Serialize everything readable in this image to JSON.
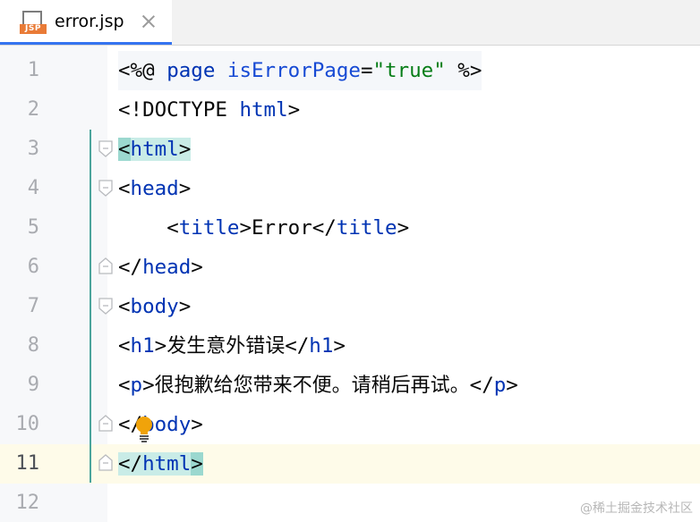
{
  "tab": {
    "file_name": "error.jsp",
    "icon_badge": "JSP",
    "icon": "jsp-file-icon",
    "close_icon": "close-icon"
  },
  "editor": {
    "line_numbers": [
      "1",
      "2",
      "3",
      "4",
      "5",
      "6",
      "7",
      "8",
      "9",
      "10",
      "11",
      "12"
    ],
    "current_line": "11",
    "code": {
      "line1": {
        "open": "<%@ ",
        "kw": "page",
        "sp": " ",
        "attr": "isErrorPage",
        "eq": "=",
        "val": "\"true\"",
        "close": " %>"
      },
      "line2": {
        "open": "<!DOCTYPE ",
        "tag": "html",
        "close": ">"
      },
      "line3": {
        "open": "<",
        "tag": "html",
        "close": ">"
      },
      "line4": {
        "open": "<",
        "tag": "head",
        "close": ">"
      },
      "line5": {
        "indent": "    ",
        "open": "<",
        "tag": "title",
        "mid": ">",
        "text": "Error",
        "open2": "</",
        "tag2": "title",
        "close": ">"
      },
      "line6": {
        "open": "</",
        "tag": "head",
        "close": ">"
      },
      "line7": {
        "open": "<",
        "tag": "body",
        "close": ">"
      },
      "line8": {
        "open": "<",
        "tag": "h1",
        "mid": ">",
        "text": "发生意外错误",
        "open2": "</",
        "tag2": "h1",
        "close": ">"
      },
      "line9": {
        "open": "<",
        "tag": "p",
        "mid": ">",
        "text": "很抱歉给您带来不便。请稍后再试。",
        "open2": "</",
        "tag2": "p",
        "close": ">"
      },
      "line10": {
        "open": "</",
        "tag": "body",
        "close": ">"
      },
      "line11": {
        "open": "</",
        "tag": "html",
        "close": ">"
      }
    },
    "intention_icon": "lightbulb-icon"
  },
  "colors": {
    "tag": "#0033b3",
    "attribute": "#174ad4",
    "string": "#067d17",
    "text": "#080808",
    "matched_tag_bg": "#c9ece7",
    "current_line_bg": "#fefbe9",
    "tab_accent": "#3574f0",
    "jsp_badge": "#e97b37",
    "bulb": "#f0a30a"
  },
  "watermark": "@稀土掘金技术社区"
}
